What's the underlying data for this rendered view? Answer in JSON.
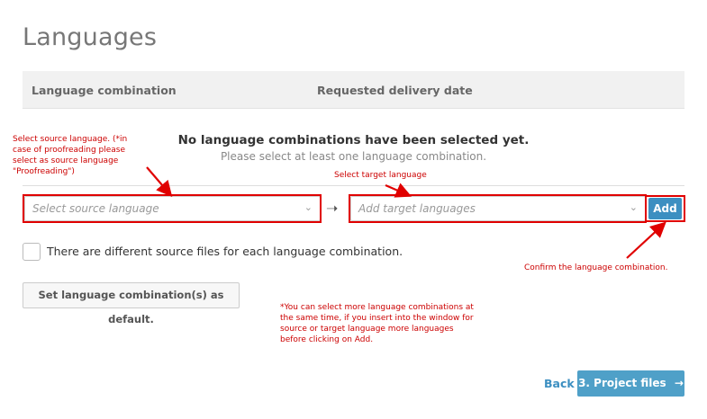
{
  "page": {
    "title": "Languages"
  },
  "table": {
    "columns": [
      "Language combination",
      "Requested delivery date"
    ]
  },
  "empty_state": {
    "title": "No language combinations have been selected yet.",
    "subtitle": "Please select at least one language combination."
  },
  "form": {
    "source_placeholder": "Select source language",
    "target_placeholder": "Add target languages",
    "add_label": "Add",
    "different_files_label": "There are different source files for each language combination.",
    "different_files_checked": false,
    "set_default_label": "Set language combination(s) as default."
  },
  "footer": {
    "back_label": "Back",
    "next_label": "3. Project files"
  },
  "annotations": {
    "source_note": "Select source language. (*in case of proofreading please select as source language \"Proofreading\")",
    "target_note": "Select target language",
    "confirm_note": "Confirm the language combination.",
    "multi_note": "*You can select more language combinations at the same time, if you insert into the window for source or target language more languages before clicking on Add."
  },
  "colors": {
    "accent": "#3c8fc1",
    "annotation": "#cc0000",
    "highlight_box": "#e00000"
  },
  "icons": {
    "chevron": "chevron-down-icon",
    "arrow": "arrow-right-icon",
    "next_arrow": "arrow-right-icon"
  }
}
